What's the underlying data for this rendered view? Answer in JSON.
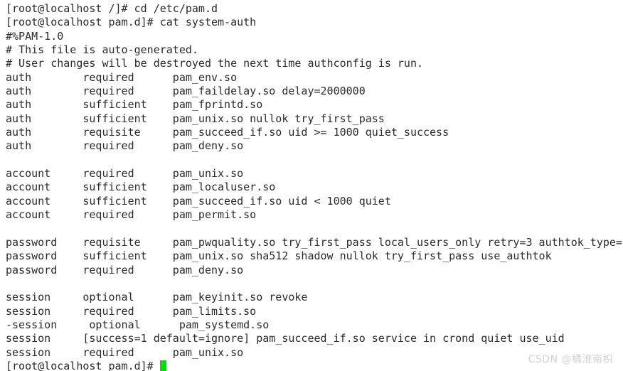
{
  "terminal": {
    "background_color": "#ffffff",
    "text_color": "#2b2b2b",
    "cursor_color": "#00e000",
    "lines": [
      "[root@localhost /]# cd /etc/pam.d",
      "[root@localhost pam.d]# cat system-auth",
      "#%PAM-1.0",
      "# This file is auto-generated.",
      "# User changes will be destroyed the next time authconfig is run.",
      "auth        required      pam_env.so",
      "auth        required      pam_faildelay.so delay=2000000",
      "auth        sufficient    pam_fprintd.so",
      "auth        sufficient    pam_unix.so nullok try_first_pass",
      "auth        requisite     pam_succeed_if.so uid >= 1000 quiet_success",
      "auth        required      pam_deny.so",
      "",
      "account     required      pam_unix.so",
      "account     sufficient    pam_localuser.so",
      "account     sufficient    pam_succeed_if.so uid < 1000 quiet",
      "account     required      pam_permit.so",
      "",
      "password    requisite     pam_pwquality.so try_first_pass local_users_only retry=3 authtok_type=",
      "password    sufficient    pam_unix.so sha512 shadow nullok try_first_pass use_authtok",
      "password    required      pam_deny.so",
      "",
      "session     optional      pam_keyinit.so revoke",
      "session     required      pam_limits.so",
      "-session     optional      pam_systemd.so",
      "session     [success=1 default=ignore] pam_succeed_if.so service in crond quiet use_uid",
      "session     required      pam_unix.so"
    ],
    "prompt_line": "[root@localhost pam.d]# ",
    "commands": [
      "cd /etc/pam.d",
      "cat system-auth"
    ],
    "hostname": "localhost",
    "user": "root",
    "working_directory": "/etc/pam.d",
    "file_shown": "system-auth"
  },
  "watermark": {
    "text": "CSDN @橘淮南枳"
  }
}
